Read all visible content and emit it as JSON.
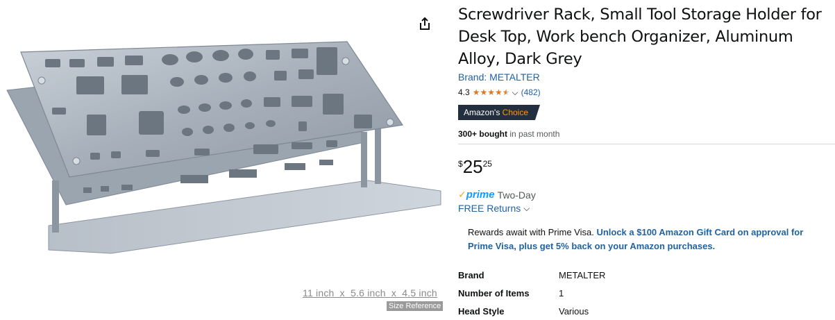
{
  "product": {
    "title": "Screwdriver Rack, Small Tool Storage Holder for Desk Top, Work bench Organizer, Aluminum Alloy, Dark Grey",
    "brand_link": "Brand: METALTER",
    "rating_value": "4.3",
    "rating_stars": 4.3,
    "review_count": "(482)",
    "badge": {
      "prefix": "Amazon's",
      "accent": "Choice"
    },
    "bought": {
      "bold": "300+ bought",
      "rest": " in past month"
    },
    "price": {
      "symbol": "$",
      "whole": "25",
      "fraction": "25"
    },
    "prime": {
      "logo": "prime",
      "text": "Two-Day"
    },
    "returns": "FREE Returns",
    "rewards": {
      "text": "Rewards await with Prime Visa. ",
      "link": "Unlock a $100 Amazon Gift Card on approval for Prime Visa, plus get 5% back on your Amazon purchases."
    },
    "specs": [
      {
        "key": "Brand",
        "value": "METALTER"
      },
      {
        "key": "Number of Items",
        "value": "1"
      },
      {
        "key": "Head Style",
        "value": "Various"
      }
    ]
  },
  "image_panel": {
    "size_text": "11 inch  x  5.6 inch  x  4.5 inch",
    "size_reference": "Size Reference"
  },
  "colors": {
    "link": "#2162a1",
    "star": "#de7921",
    "badge_bg": "#232f3e",
    "badge_accent": "#ff9900",
    "prime": "#1399ff"
  },
  "icons": {
    "share": "share-icon",
    "chevron": "chevron-down-icon",
    "prime_check": "check-icon"
  }
}
